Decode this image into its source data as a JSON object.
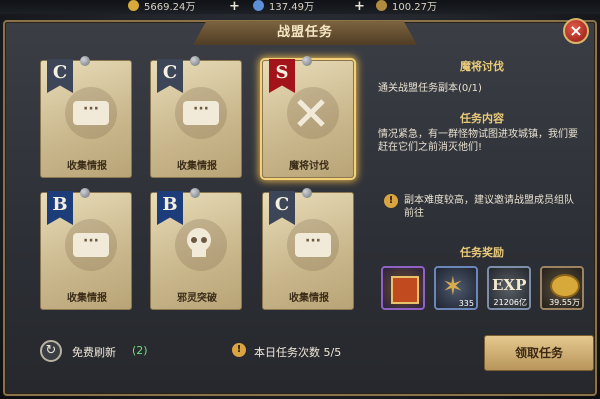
{
  "resources": [
    {
      "value": "5669.24万",
      "icon": "gold-coin-icon"
    },
    {
      "value": "137.49万",
      "icon": "blue-crystal-icon"
    },
    {
      "value": "100.27万",
      "icon": "star-medal-icon"
    }
  ],
  "window": {
    "title": "战盟任务"
  },
  "cards": [
    {
      "grade": "C",
      "label": "收集情报",
      "icon": "chat-bubble-icon"
    },
    {
      "grade": "C",
      "label": "收集情报",
      "icon": "chat-bubble-icon"
    },
    {
      "grade": "S",
      "label": "魔将讨伐",
      "icon": "crossed-swords-icon"
    },
    {
      "grade": "B",
      "label": "收集情报",
      "icon": "chat-bubble-icon"
    },
    {
      "grade": "B",
      "label": "邪灵突破",
      "icon": "skull-icon"
    },
    {
      "grade": "C",
      "label": "收集情报",
      "icon": "chat-bubble-icon"
    }
  ],
  "detail": {
    "task_name": "魔将讨伐",
    "objective": "通关战盟任务副本(0/1)",
    "content_heading": "任务内容",
    "content": "情况紧急，有一群怪物试图进攻城镇，我们要赶在它们之前消灭他们!",
    "warning": "副本难度较高，建议邀请战盟成员组队前往",
    "rewards_heading": "任务奖励",
    "rewards": [
      {
        "name": "gift-box-icon",
        "count": ""
      },
      {
        "name": "star-medal-icon",
        "count": "335"
      },
      {
        "name": "exp-icon",
        "label": "EXP",
        "count": "21206亿"
      },
      {
        "name": "gold-coin-icon",
        "count": "39.55万"
      }
    ]
  },
  "footer": {
    "refresh_label": "免费刷新",
    "refresh_count": "(2)",
    "daily_label": "本日任务次数 5/5",
    "claim_label": "领取任务"
  }
}
